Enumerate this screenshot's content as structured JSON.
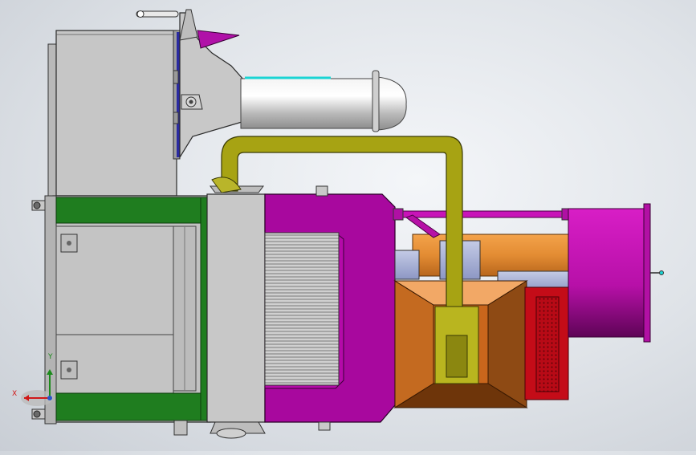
{
  "viewport": {
    "background": "#dfe3e8",
    "triad": {
      "x_label": "X",
      "y_label": "Y",
      "x_color": "#d01818",
      "y_color": "#1b8a1b"
    }
  },
  "colors": {
    "housing_gray": "#c6c6c6",
    "frame_green": "#1f7d1f",
    "intake_magenta": "#a8089e",
    "pipe_olive": "#a7a313",
    "muffler_silver": "#d7d7d7",
    "blower_orange": "#d47a24",
    "hopper_brown": "#a55515",
    "panel_red": "#c40c18",
    "blower_end_magenta": "#c814b8",
    "shutter_navy": "#2a2aa0",
    "exhaust_tip_magenta": "#a80c9c"
  }
}
